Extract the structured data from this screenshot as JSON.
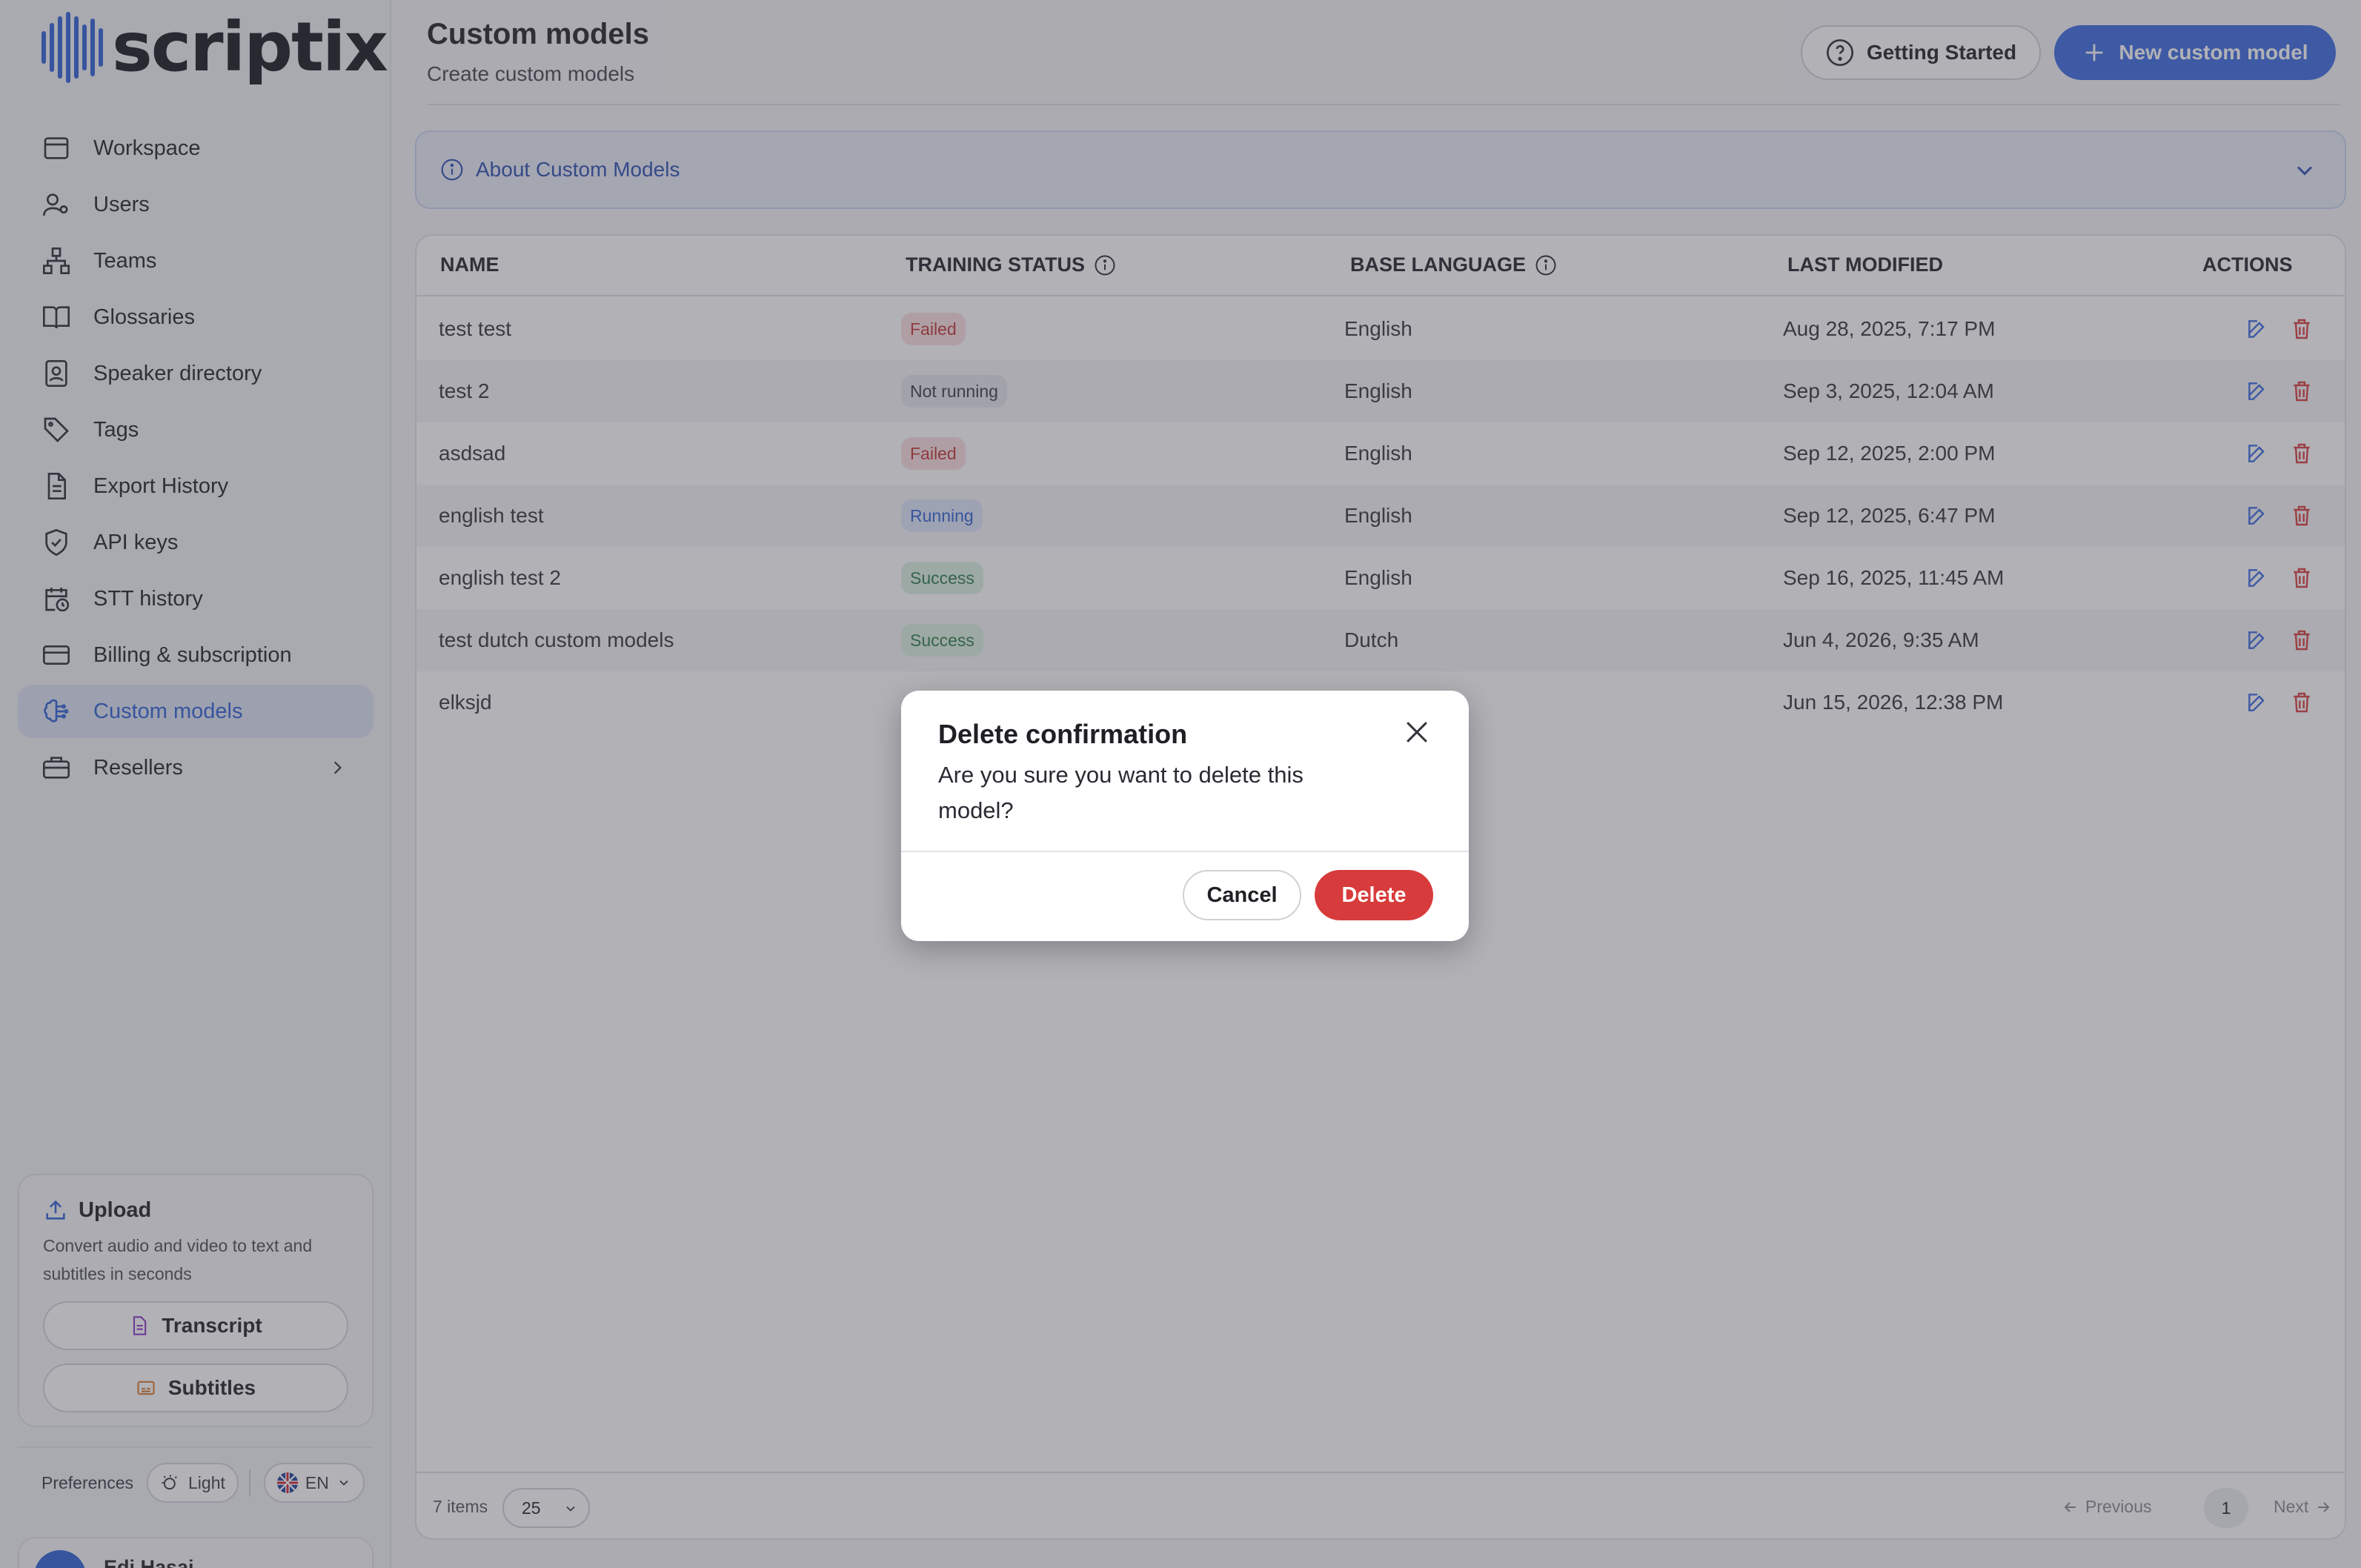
{
  "brand": {
    "name": "scriptix",
    "color": "#2d5fd6"
  },
  "sidebar": {
    "items": [
      {
        "label": "Workspace",
        "icon": "workspace-icon"
      },
      {
        "label": "Users",
        "icon": "users-icon"
      },
      {
        "label": "Teams",
        "icon": "teams-icon"
      },
      {
        "label": "Glossaries",
        "icon": "book-icon"
      },
      {
        "label": "Speaker directory",
        "icon": "speaker-directory-icon"
      },
      {
        "label": "Tags",
        "icon": "tag-icon"
      },
      {
        "label": "Export History",
        "icon": "document-icon"
      },
      {
        "label": "API keys",
        "icon": "shield-icon"
      },
      {
        "label": "STT history",
        "icon": "calendar-clock-icon"
      },
      {
        "label": "Billing & subscription",
        "icon": "credit-card-icon"
      },
      {
        "label": "Custom models",
        "icon": "brain-icon",
        "active": true
      },
      {
        "label": "Resellers",
        "icon": "briefcase-icon"
      }
    ],
    "upload": {
      "title": "Upload",
      "description": "Convert audio and video to text and subtitles in seconds",
      "transcript_label": "Transcript",
      "subtitles_label": "Subtitles"
    },
    "preferences": {
      "label": "Preferences",
      "theme": "Light",
      "language": "EN"
    },
    "user": {
      "name": "Edi Hasaj"
    }
  },
  "header": {
    "title": "Custom models",
    "subtitle": "Create custom models",
    "getting_started_label": "Getting Started",
    "new_model_label": "New custom model"
  },
  "about": {
    "label": "About Custom Models"
  },
  "table": {
    "columns": {
      "name": "NAME",
      "status": "TRAINING STATUS",
      "language": "BASE LANGUAGE",
      "modified": "LAST MODIFIED",
      "actions": "ACTIONS"
    },
    "rows": [
      {
        "name": "test test",
        "status": "Failed",
        "status_kind": "failed",
        "language": "English",
        "modified": "Aug 28, 2025, 7:17 PM"
      },
      {
        "name": "test 2",
        "status": "Not running",
        "status_kind": "notrun",
        "language": "English",
        "modified": "Sep 3, 2025, 12:04 AM"
      },
      {
        "name": "asdsad",
        "status": "Failed",
        "status_kind": "failed",
        "language": "English",
        "modified": "Sep 12, 2025, 2:00 PM"
      },
      {
        "name": "english test",
        "status": "Running",
        "status_kind": "running",
        "language": "English",
        "modified": "Sep 12, 2025, 6:47 PM"
      },
      {
        "name": "english test 2",
        "status": "Success",
        "status_kind": "success",
        "language": "English",
        "modified": "Sep 16, 2025, 11:45 AM"
      },
      {
        "name": "test dutch custom models",
        "status": "Success",
        "status_kind": "success",
        "language": "Dutch",
        "modified": "Jun 4, 2026, 9:35 AM"
      },
      {
        "name": "elksjd",
        "status": "",
        "status_kind": "",
        "language": "",
        "modified": "Jun 15, 2026, 12:38 PM"
      }
    ],
    "footer": {
      "items_count": "7 items",
      "per_page": "25",
      "previous": "Previous",
      "page": "1",
      "next": "Next"
    }
  },
  "modal": {
    "title": "Delete confirmation",
    "body": "Are you sure you want to delete this model?",
    "cancel_label": "Cancel",
    "delete_label": "Delete"
  },
  "colors": {
    "accent": "#3a6ae0",
    "danger": "#d83b3b",
    "failed": "#c23434",
    "running": "#2d5fd6",
    "success": "#2c7a45"
  }
}
